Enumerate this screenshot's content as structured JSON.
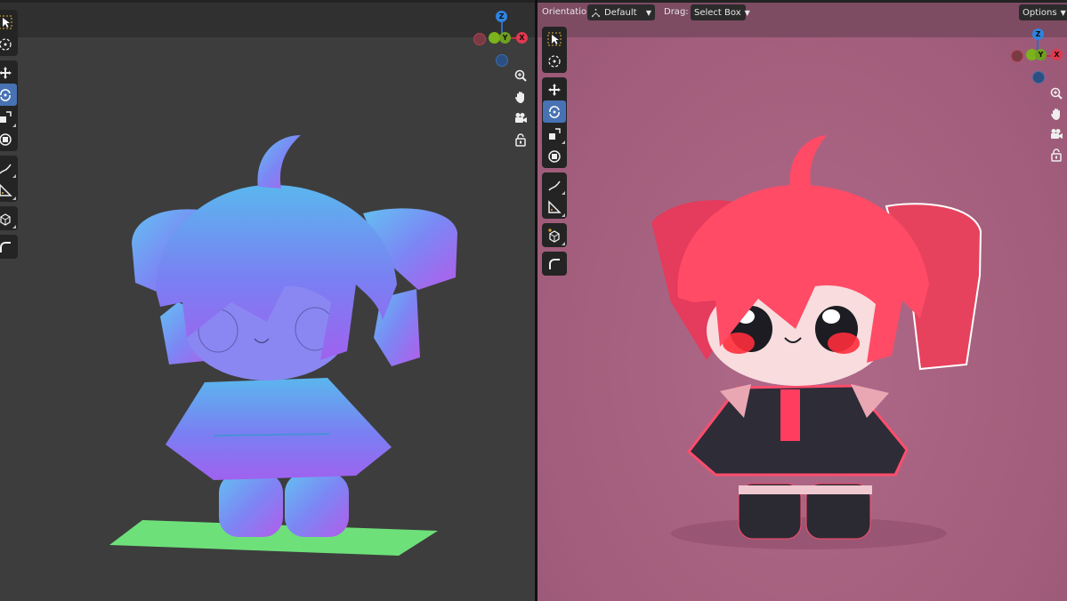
{
  "right_header": {
    "orientation_label": "Orientation:",
    "orientation_value": "Default",
    "drag_label": "Drag:",
    "drag_value": "Select Box",
    "options_label": "Options"
  },
  "gizmo": {
    "z": "Z",
    "y": "Y",
    "x": "X"
  },
  "icons": {
    "toolbar": [
      "select-box-icon",
      "cursor-icon",
      "move-icon",
      "rotate-icon",
      "scale-icon",
      "transform-icon",
      "annotate-icon",
      "measure-icon",
      "add-cube-icon",
      "shear-icon"
    ],
    "navigation": [
      "zoom-icon",
      "hand-pan-icon",
      "camera-icon",
      "lock-icon"
    ]
  },
  "colors": {
    "left_bg": "#3d3d3d",
    "right_bg": "#a5607e",
    "active_tool": "#4772b3",
    "axis_x": "#e0394f",
    "axis_y": "#7cb21d",
    "axis_z": "#2f83e0"
  }
}
